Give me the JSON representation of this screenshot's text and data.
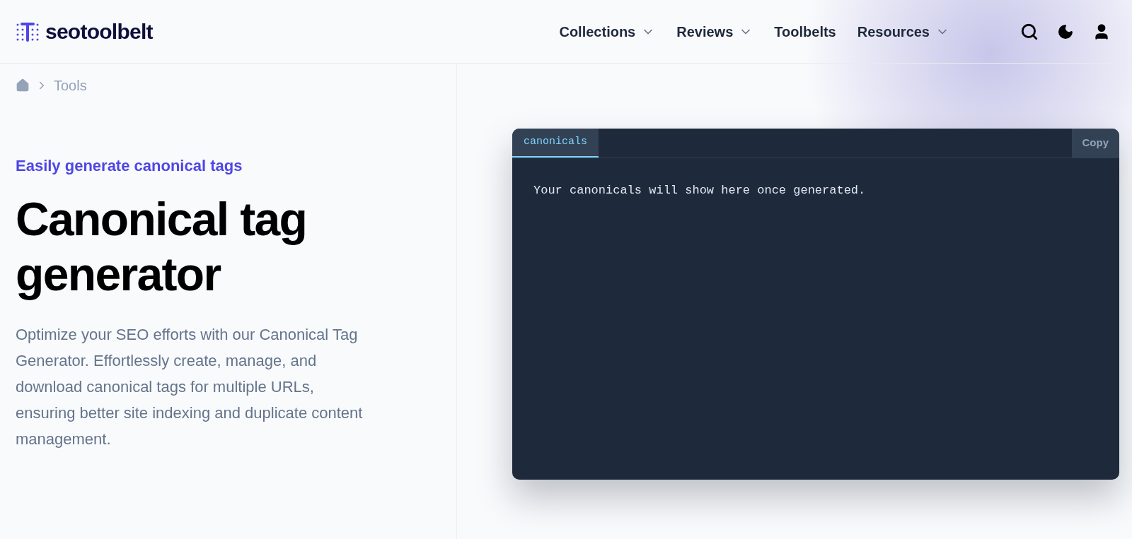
{
  "logo": {
    "text": "seotoolbelt"
  },
  "nav": [
    {
      "label": "Collections",
      "dropdown": true
    },
    {
      "label": "Reviews",
      "dropdown": true
    },
    {
      "label": "Toolbelts",
      "dropdown": false
    },
    {
      "label": "Resources",
      "dropdown": true
    }
  ],
  "breadcrumb": [
    "Tools"
  ],
  "eyebrow": "Easily generate canonical tags",
  "title": "Canonical tag generator",
  "description": "Optimize your SEO efforts with our Canonical Tag Generator. Effortlessly create, manage, and download canonical tags for multiple URLs, ensuring better site indexing and duplicate content management.",
  "code_panel": {
    "tabs": [
      {
        "label": "canonicals",
        "selected": true
      }
    ],
    "copy_button": "Copy",
    "output": "Your canonicals will show here once generated."
  }
}
